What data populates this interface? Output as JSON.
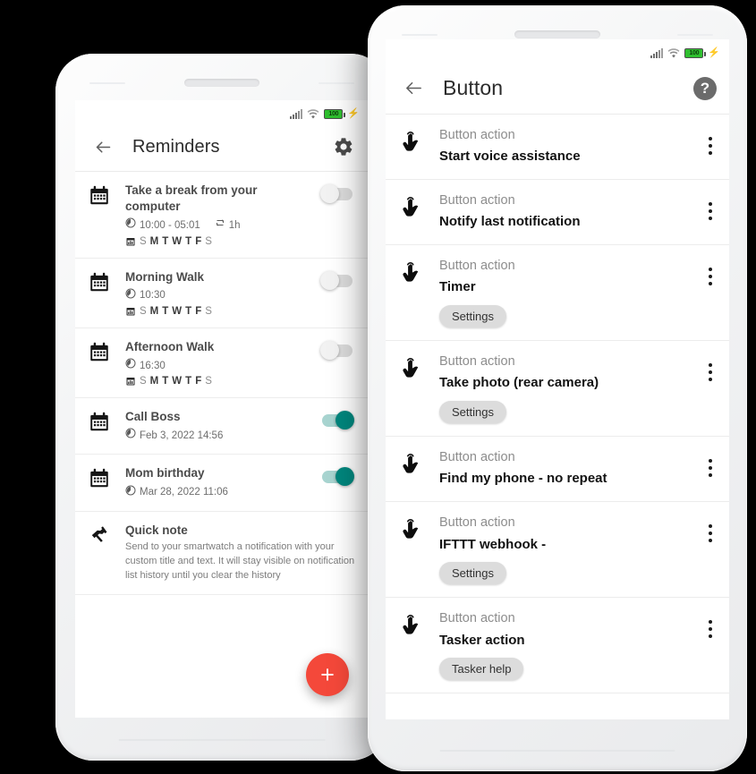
{
  "status_bar": {
    "battery_text": "100",
    "icons": [
      "signal-icon",
      "wifi-icon",
      "battery-icon",
      "charging-bolt-icon"
    ]
  },
  "left_phone": {
    "appbar": {
      "title": "Reminders",
      "back_icon": "back-arrow-icon",
      "settings_icon": "gear-icon"
    },
    "fab": {
      "label": "+"
    },
    "reminders": [
      {
        "icon": "calendar-icon",
        "title": "Take a break from your computer",
        "time": "10:00 - 05:01",
        "repeat": "1h",
        "has_repeat": true,
        "days": [
          {
            "letter": "S",
            "active": false
          },
          {
            "letter": "M",
            "active": true
          },
          {
            "letter": "T",
            "active": true
          },
          {
            "letter": "W",
            "active": true
          },
          {
            "letter": "T",
            "active": true
          },
          {
            "letter": "F",
            "active": true
          },
          {
            "letter": "S",
            "active": false
          }
        ],
        "enabled": false
      },
      {
        "icon": "calendar-icon",
        "title": "Morning Walk",
        "time": "10:30",
        "repeat": "",
        "has_repeat": false,
        "days": [
          {
            "letter": "S",
            "active": false
          },
          {
            "letter": "M",
            "active": true
          },
          {
            "letter": "T",
            "active": true
          },
          {
            "letter": "W",
            "active": true
          },
          {
            "letter": "T",
            "active": true
          },
          {
            "letter": "F",
            "active": true
          },
          {
            "letter": "S",
            "active": false
          }
        ],
        "enabled": false
      },
      {
        "icon": "calendar-icon",
        "title": "Afternoon Walk",
        "time": "16:30",
        "repeat": "",
        "has_repeat": false,
        "days": [
          {
            "letter": "S",
            "active": false
          },
          {
            "letter": "M",
            "active": true
          },
          {
            "letter": "T",
            "active": true
          },
          {
            "letter": "W",
            "active": true
          },
          {
            "letter": "T",
            "active": true
          },
          {
            "letter": "F",
            "active": true
          },
          {
            "letter": "S",
            "active": false
          }
        ],
        "enabled": false
      },
      {
        "icon": "calendar-icon",
        "title": "Call Boss",
        "time": "Feb 3, 2022 14:56",
        "repeat": "",
        "has_repeat": false,
        "days": [],
        "enabled": true
      },
      {
        "icon": "calendar-icon",
        "title": "Mom birthday",
        "time": "Mar 28, 2022 11:06",
        "repeat": "",
        "has_repeat": false,
        "days": [],
        "enabled": true
      }
    ],
    "quick_note": {
      "icon": "note-icon",
      "title": "Quick note",
      "description": "Send to your smartwatch a notification with your custom title and text. It will stay visible on notification list history until you clear the history"
    }
  },
  "right_phone": {
    "appbar": {
      "title": "Button",
      "back_icon": "back-arrow-icon",
      "help_icon": "help-icon"
    },
    "actions": [
      {
        "icon": "tap-hand-icon",
        "label": "Button action",
        "value": "Start voice assistance",
        "chip": null,
        "menu_icon": "kebab-menu-icon"
      },
      {
        "icon": "tap-hand-icon",
        "label": "Button action",
        "value": "Notify last notification",
        "chip": null,
        "menu_icon": "kebab-menu-icon"
      },
      {
        "icon": "tap-hand-icon",
        "label": "Button action",
        "value": "Timer",
        "chip": "Settings",
        "menu_icon": "kebab-menu-icon"
      },
      {
        "icon": "tap-hand-icon",
        "label": "Button action",
        "value": "Take photo (rear camera)",
        "chip": "Settings",
        "menu_icon": "kebab-menu-icon"
      },
      {
        "icon": "tap-hand-icon",
        "label": "Button action",
        "value": "Find my phone - no repeat",
        "chip": null,
        "menu_icon": "kebab-menu-icon"
      },
      {
        "icon": "tap-hand-icon",
        "label": "Button action",
        "value": "IFTTT webhook - ",
        "chip": "Settings",
        "menu_icon": "kebab-menu-icon"
      },
      {
        "icon": "tap-hand-icon",
        "label": "Button action",
        "value": "Tasker action",
        "chip": "Tasker help",
        "menu_icon": "kebab-menu-icon"
      }
    ]
  },
  "colors": {
    "accent_toggle": "#00867d",
    "fab": "#f4483a",
    "battery": "#2fbf2f",
    "chip": "#dcdcdc"
  }
}
